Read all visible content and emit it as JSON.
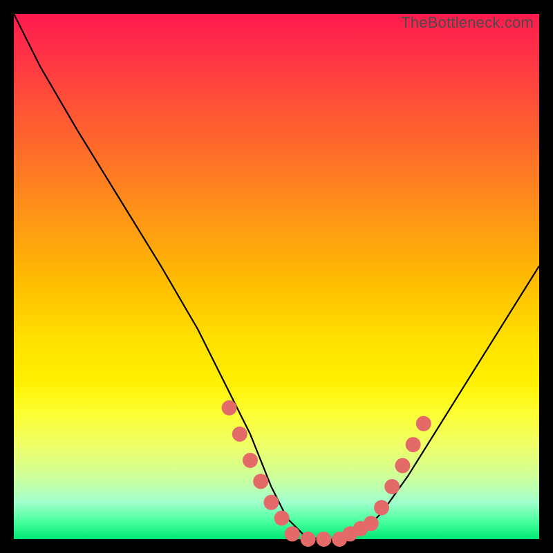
{
  "watermark": "TheBottleneck.com",
  "chart_data": {
    "type": "line",
    "title": "",
    "xlabel": "",
    "ylabel": "",
    "xlim": [
      0,
      100
    ],
    "ylim": [
      0,
      100
    ],
    "series": [
      {
        "name": "bottleneck-curve",
        "x": [
          0,
          5,
          12,
          20,
          28,
          35,
          40,
          45,
          49,
          52,
          55,
          58,
          62,
          66,
          70,
          75,
          80,
          85,
          90,
          95,
          100
        ],
        "values": [
          100,
          90,
          78,
          65,
          52,
          40,
          30,
          20,
          10,
          4,
          1,
          0,
          0,
          1,
          5,
          12,
          20,
          28,
          36,
          44,
          52
        ]
      },
      {
        "name": "highlight-dots-left",
        "x": [
          41,
          43,
          45,
          47,
          49,
          51
        ],
        "values": [
          25,
          20,
          15,
          11,
          7,
          4
        ]
      },
      {
        "name": "highlight-dots-bottom",
        "x": [
          53,
          56,
          59,
          62,
          64,
          66,
          68
        ],
        "values": [
          1,
          0,
          0,
          0,
          1,
          2,
          3
        ]
      },
      {
        "name": "highlight-dots-right",
        "x": [
          70,
          72,
          74,
          76,
          78
        ],
        "values": [
          6,
          10,
          14,
          18,
          22
        ]
      }
    ],
    "colors": {
      "curve": "#000000",
      "dots": "#e46a6a",
      "gradient_top": "#ff1a4d",
      "gradient_bottom": "#00e676"
    }
  }
}
